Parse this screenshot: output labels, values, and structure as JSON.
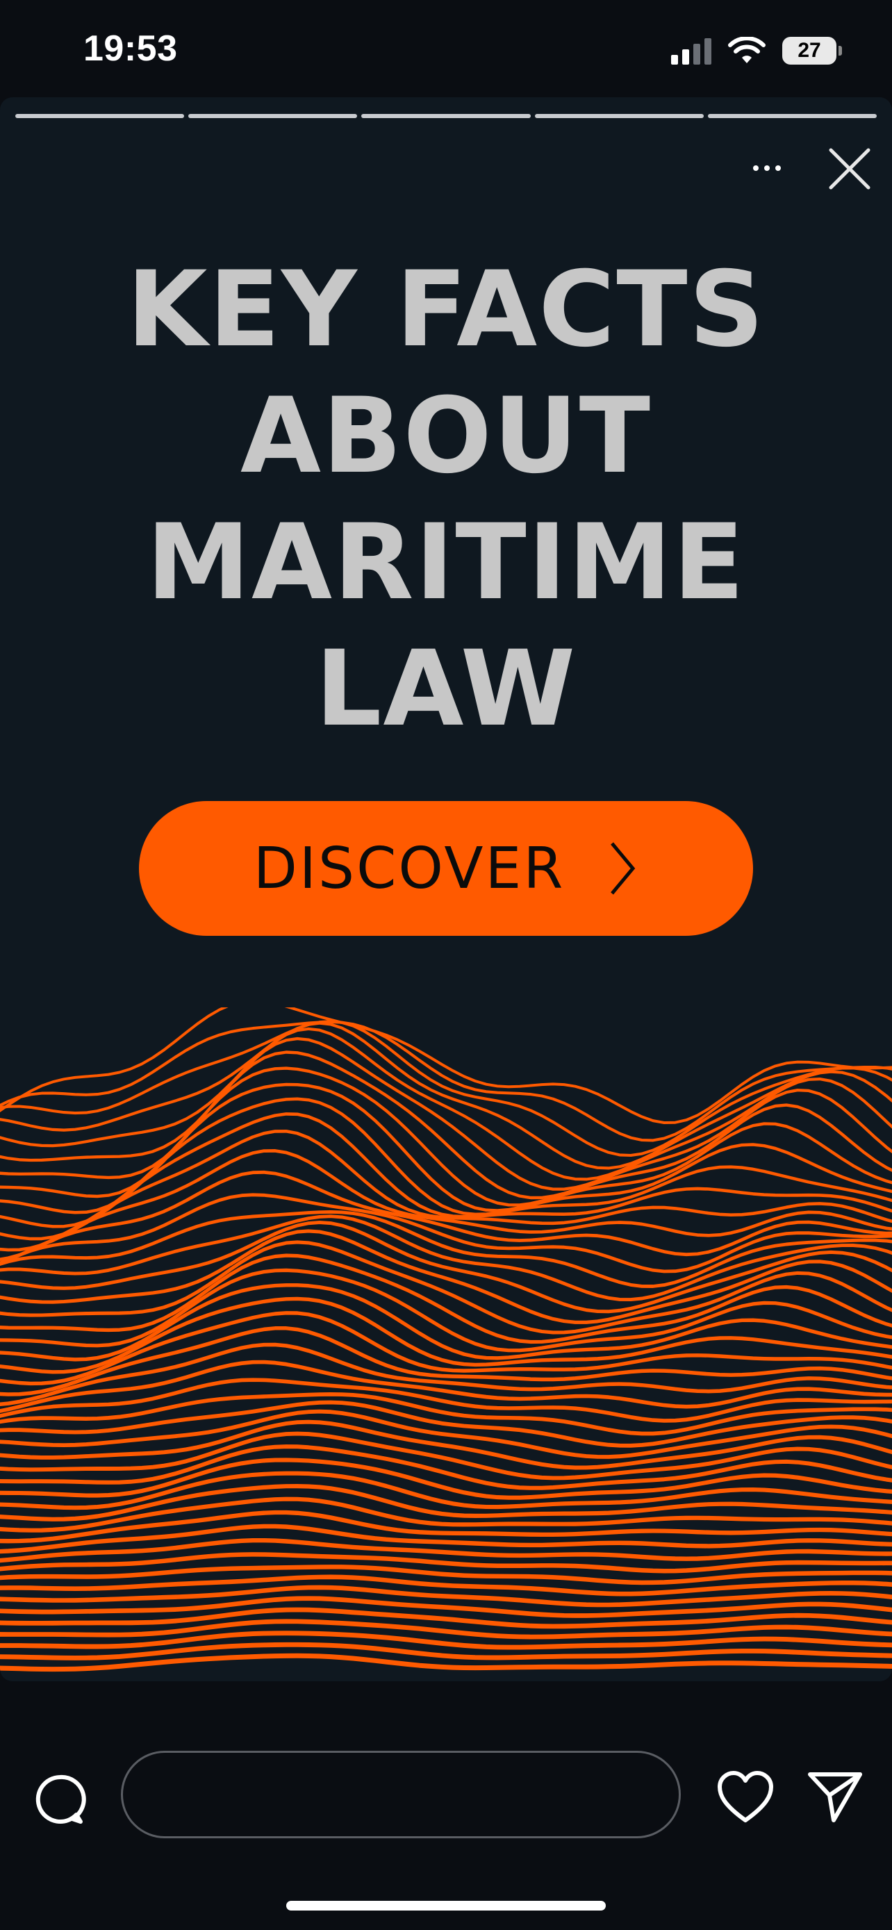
{
  "status_bar": {
    "time": "19:53",
    "battery_level": "27",
    "icons": [
      "cellular-signal-icon",
      "wifi-icon",
      "battery-icon"
    ]
  },
  "story": {
    "progress_segments": 5,
    "headline_lines": [
      "KEY FACTS",
      "ABOUT",
      "MARITIME",
      "LAW"
    ],
    "cta_label": "DISCOVER",
    "icons": [
      "more-options-icon",
      "close-icon",
      "chevron-right-icon"
    ],
    "colors": {
      "background": "#0f1820",
      "headline": "#c7c7c7",
      "accent": "#ff5a00"
    }
  },
  "reply_bar": {
    "input_placeholder": "",
    "icons": [
      "comment-bubble-icon",
      "heart-icon",
      "send-icon"
    ]
  }
}
